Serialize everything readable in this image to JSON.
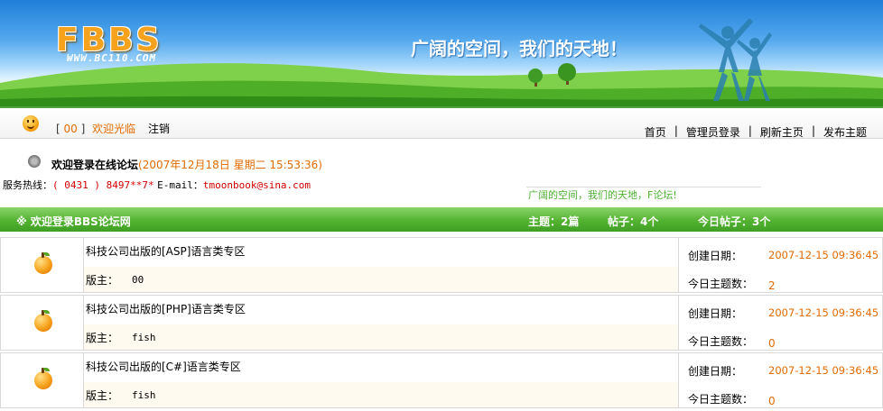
{
  "banner": {
    "logo": "FBBS",
    "logo_url": "WWW.BC110.COM",
    "slogan": "广阔的空间，我们的天地！"
  },
  "nav": {
    "bracket_open": "[",
    "username": "00",
    "bracket_close": "]",
    "welcome": "欢迎光临",
    "logout": "注销",
    "links": [
      "首页",
      "管理员登录",
      "刷新主页",
      "发布主题"
    ],
    "separator": "|"
  },
  "info": {
    "welcome_text": "欢迎登录在线论坛",
    "datetime": "(2007年12月18日 星期二 15:53:36)",
    "hotline_label": "服务热线：",
    "hotline": "( 0431 ) 8497**7*",
    "email_label": "E-mail：",
    "email": "tmoonbook@sina.com",
    "slogan": "广阔的空间，我们的天地，F论坛!"
  },
  "board_header": {
    "icon": "※",
    "title": "欢迎登录BBS论坛网",
    "topics": "主题：2篇",
    "posts": "帖子：4个",
    "today_posts": "今日帖子：3个"
  },
  "forums": [
    {
      "name": "科技公司出版的[ASP]语言类专区",
      "moderator_label": "版主：",
      "moderator": "00",
      "created_label": "创建日期：",
      "created": "2007-12-15 09:36:45",
      "today_label": "今日主题数：",
      "today_count": "2"
    },
    {
      "name": "科技公司出版的[PHP]语言类专区",
      "moderator_label": "版主：",
      "moderator": "fish",
      "created_label": "创建日期：",
      "created": "2007-12-15 09:36:45",
      "today_label": "今日主题数：",
      "today_count": "0"
    },
    {
      "name": "科技公司出版的[C#]语言类专区",
      "moderator_label": "版主：",
      "moderator": "fish",
      "created_label": "创建日期：",
      "created": "2007-12-15 09:36:45",
      "today_label": "今日主题数：",
      "today_count": "0"
    }
  ],
  "colors": {
    "green": "#53b331",
    "orange": "#e06b00",
    "sky": "#1f7fd8"
  }
}
